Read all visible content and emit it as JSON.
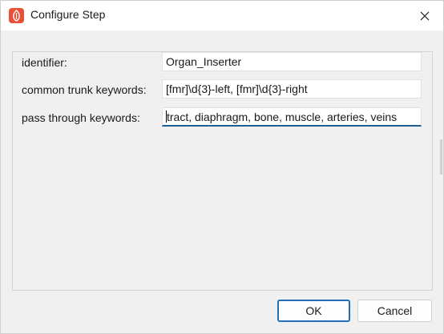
{
  "window": {
    "title": "Configure Step"
  },
  "icons": {
    "app": "app-icon",
    "close": "close-icon"
  },
  "form": {
    "fields": [
      {
        "label": "identifier:",
        "value": "Organ_Inserter"
      },
      {
        "label": "common trunk keywords:",
        "value": "[fmr]\\d{3}-left, [fmr]\\d{3}-right"
      },
      {
        "label": "pass through keywords:",
        "value": "tract, diaphragm, bone, muscle, arteries, veins"
      }
    ]
  },
  "buttons": {
    "ok": "OK",
    "cancel": "Cancel"
  },
  "colors": {
    "accent": "#1f6fb2",
    "app_icon": "#e8503a"
  }
}
